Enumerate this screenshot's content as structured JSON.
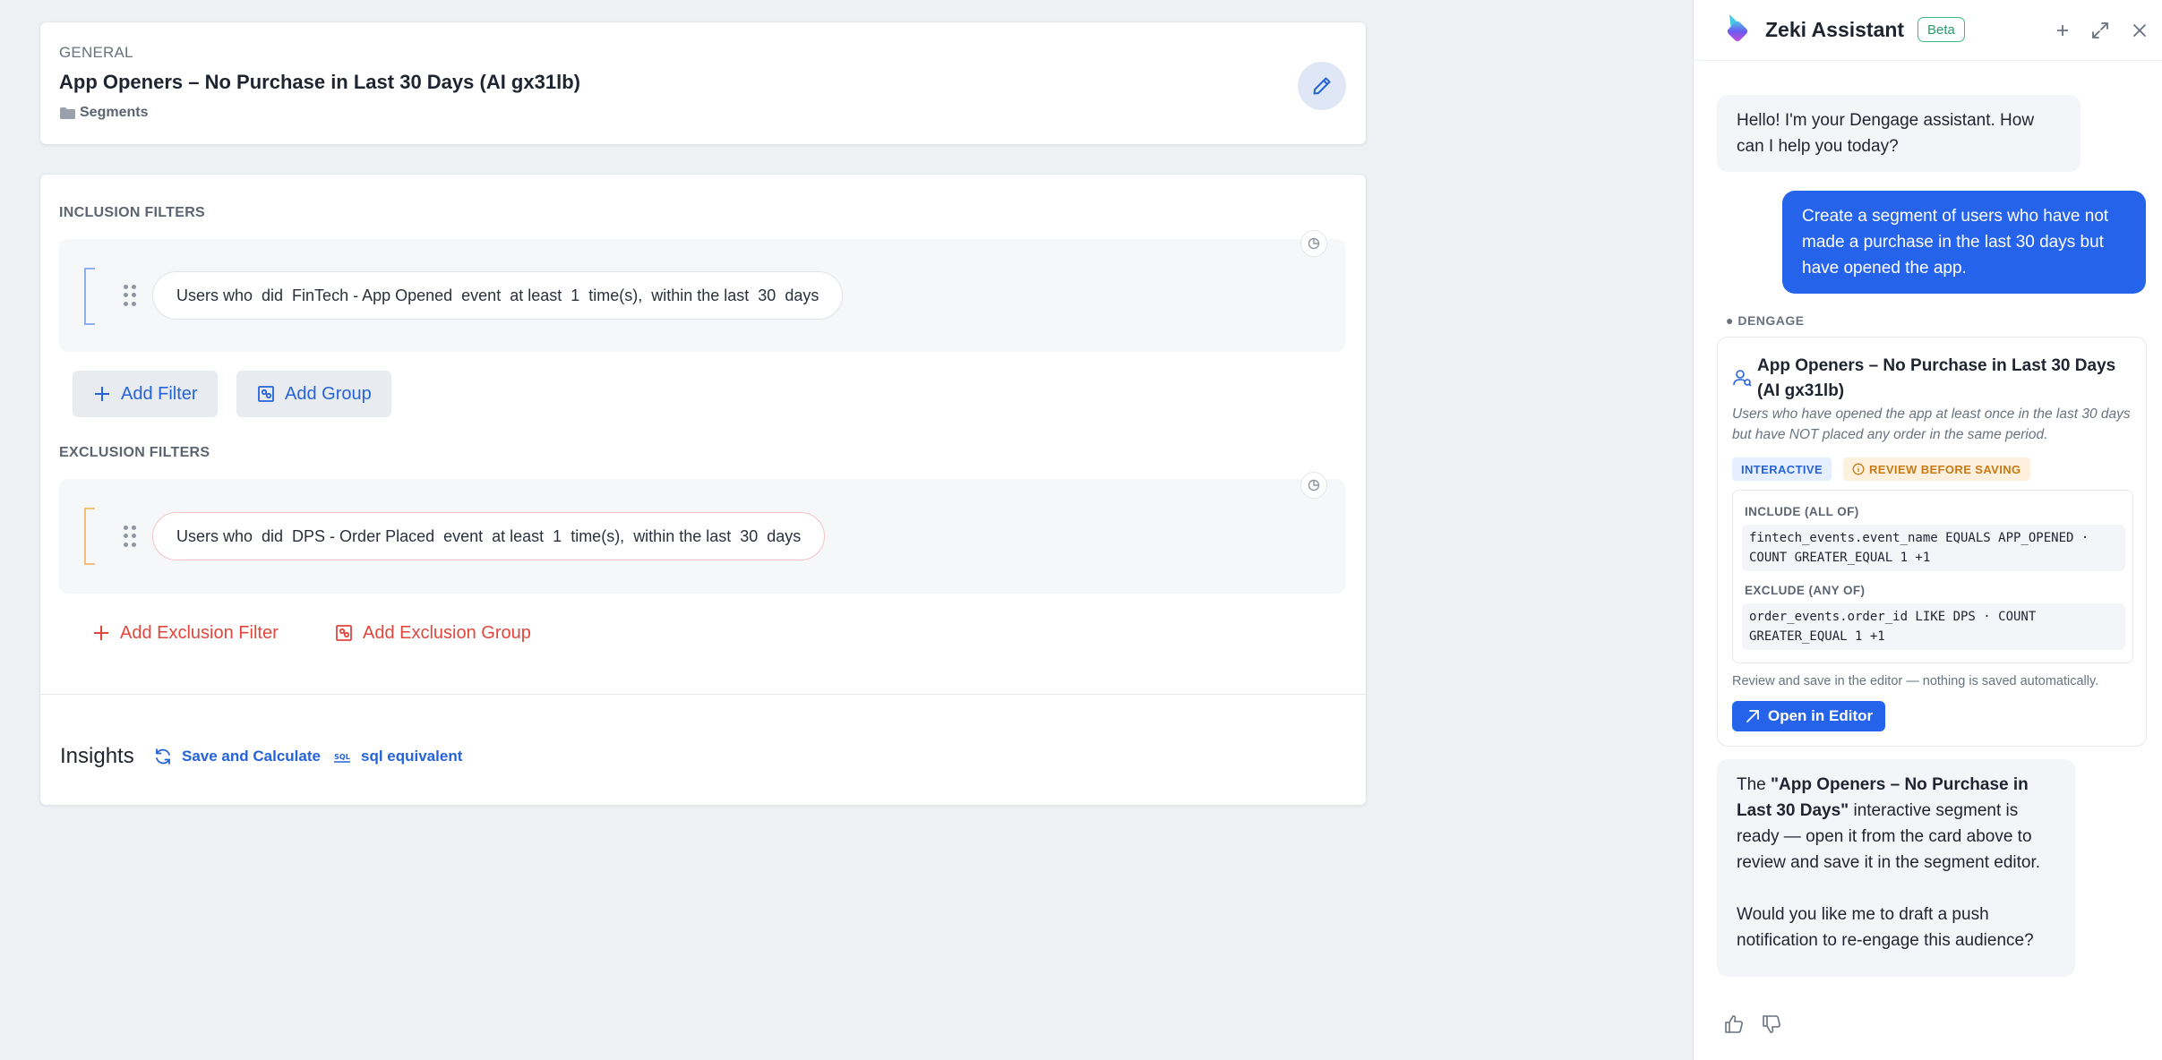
{
  "general": {
    "label": "GENERAL",
    "title": "App Openers – No Purchase in Last 30 Days (AI gx31lb)",
    "breadcrumb": "Segments"
  },
  "inclusion": {
    "label": "INCLUSION FILTERS",
    "filter": "Users who  did  FinTech - App Opened  event  at least  1  time(s),  within the last  30  days",
    "add_filter": "Add Filter",
    "add_group": "Add Group"
  },
  "exclusion": {
    "label": "EXCLUSION FILTERS",
    "filter": "Users who  did  DPS - Order Placed  event  at least  1  time(s),  within the last  30  days",
    "add_filter": "Add Exclusion Filter",
    "add_group": "Add Exclusion Group"
  },
  "insights": {
    "title": "Insights",
    "save_calc": "Save and Calculate",
    "sql": "sql equivalent"
  },
  "assistant": {
    "title": "Zeki Assistant",
    "badge": "Beta",
    "greeting": "Hello! I'm your Dengage assistant. How can I help you today?",
    "user_message": "Create a segment of users who have not made a purchase in the last 30 days but have opened the app.",
    "source_tag": "● DENGAGE",
    "card": {
      "title": "App Openers – No Purchase in Last 30 Days (AI gx31lb)",
      "description": "Users who have opened the app at least once in the last 30 days but have NOT placed any order in the same period.",
      "tag_interactive": "INTERACTIVE",
      "tag_review": "REVIEW BEFORE SAVING",
      "include_label": "INCLUDE (ALL OF)",
      "include_code": "fintech_events.event_name EQUALS APP_OPENED · COUNT GREATER_EQUAL 1 +1",
      "exclude_label": "EXCLUDE (ANY OF)",
      "exclude_code": "order_events.order_id LIKE DPS · COUNT GREATER_EQUAL 1 +1",
      "footer": "Review and save in the editor — nothing is saved automatically.",
      "open_button": "Open in Editor"
    },
    "reply_pre": "The ",
    "reply_bold": "\"App Openers – No Purchase in Last 30 Days\"",
    "reply_post": " interactive segment is ready — open it from the card above to review and save it in the segment editor.",
    "reply_question": "Would you like me to draft a push notification to re-engage this audience?"
  },
  "colors": {
    "accent": "#2563eb",
    "danger": "#e0463c",
    "success": "#3dba7f",
    "warning": "#c97a15"
  }
}
